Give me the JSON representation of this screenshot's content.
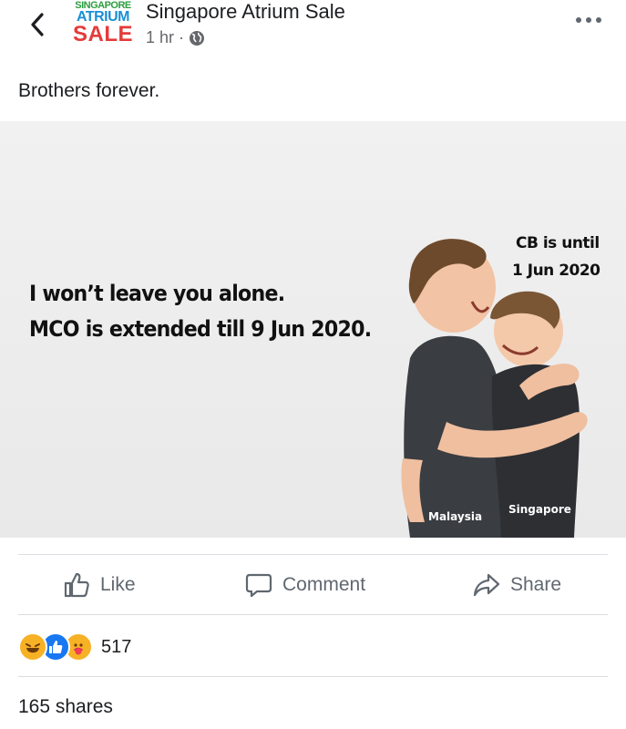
{
  "header": {
    "page_name": "Singapore Atrium Sale",
    "time": "1 hr",
    "separator": "·",
    "audience_icon": "globe-icon",
    "logo": {
      "line1": "SINGAPORE",
      "line2": "ATRIUM",
      "line3": "SALE"
    }
  },
  "post": {
    "caption": "Brothers forever.",
    "image_text": {
      "line1": "I won’t leave you alone.",
      "line2": "MCO is extended till 9 Jun 2020.",
      "cb_line1": "CB is until",
      "cb_line2": "1 Jun 2020",
      "left_tag": "Malaysia",
      "right_tag": "Singapore"
    }
  },
  "actions": {
    "like": "Like",
    "comment": "Comment",
    "share": "Share"
  },
  "reactions": {
    "icons": [
      "haha-icon",
      "like-icon",
      "care-icon"
    ],
    "count": "517"
  },
  "shares": "165 shares",
  "colors": {
    "text": "#1c1e21",
    "secondary": "#65676b",
    "like_blue": "#1877f2",
    "haha_yellow": "#f7b125",
    "divider": "#dadde1"
  }
}
